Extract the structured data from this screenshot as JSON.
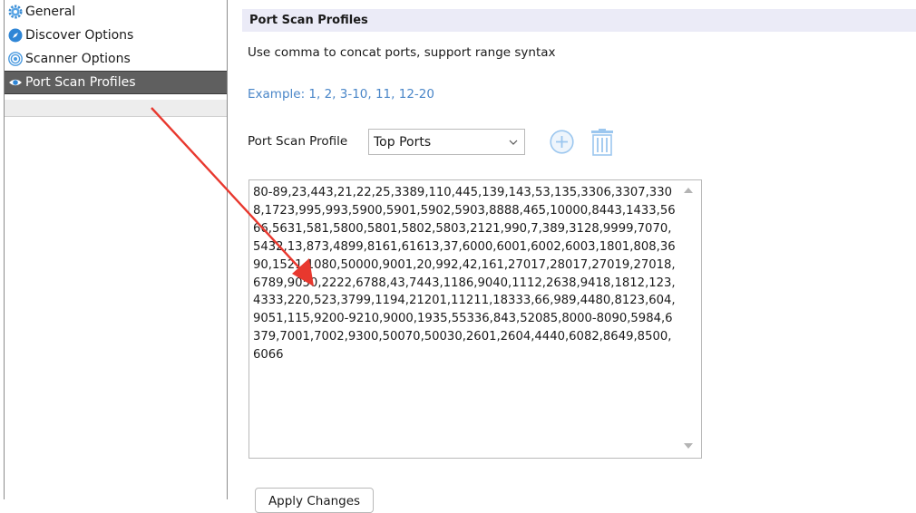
{
  "sidebar": {
    "items": [
      {
        "label": "General",
        "icon": "gear-icon"
      },
      {
        "label": "Discover Options",
        "icon": "compass-icon"
      },
      {
        "label": "Scanner Options",
        "icon": "radar-icon"
      },
      {
        "label": "Port Scan Profiles",
        "icon": "eye-icon",
        "selected": true
      }
    ]
  },
  "main": {
    "section_title": "Port Scan Profiles",
    "description": "Use comma to concat ports, support range syntax",
    "example": "Example: 1, 2, 3-10, 11, 12-20",
    "profile_label": "Port Scan Profile",
    "profile_selected": "Top Ports",
    "ports_text": "80-89,23,443,21,22,25,3389,110,445,139,143,53,135,3306,3307,3308,1723,995,993,5900,5901,5902,5903,8888,465,10000,8443,1433,5666,5631,581,5800,5801,5802,5803,2121,990,7,389,3128,9999,7070,5432,13,873,4899,8161,61613,37,6000,6001,6002,6003,1801,808,3690,1521,1080,50000,9001,20,992,42,161,27017,28017,27019,27018,6789,9050,2222,6788,43,7443,1186,9040,1112,2638,9418,1812,123,4333,220,523,3799,1194,21201,11211,18333,66,989,4480,8123,604,9051,115,9200-9210,9000,1935,55336,843,52085,8000-8090,5984,6379,7001,7002,9300,50070,50030,2601,2604,4440,6082,8649,8500,6066",
    "apply_label": "Apply Changes"
  },
  "colors": {
    "accent_blue": "#4a86c8",
    "header_bg": "#ebebf7",
    "selected_bg": "#5f5f5f",
    "annotation_red": "#e8382e"
  }
}
